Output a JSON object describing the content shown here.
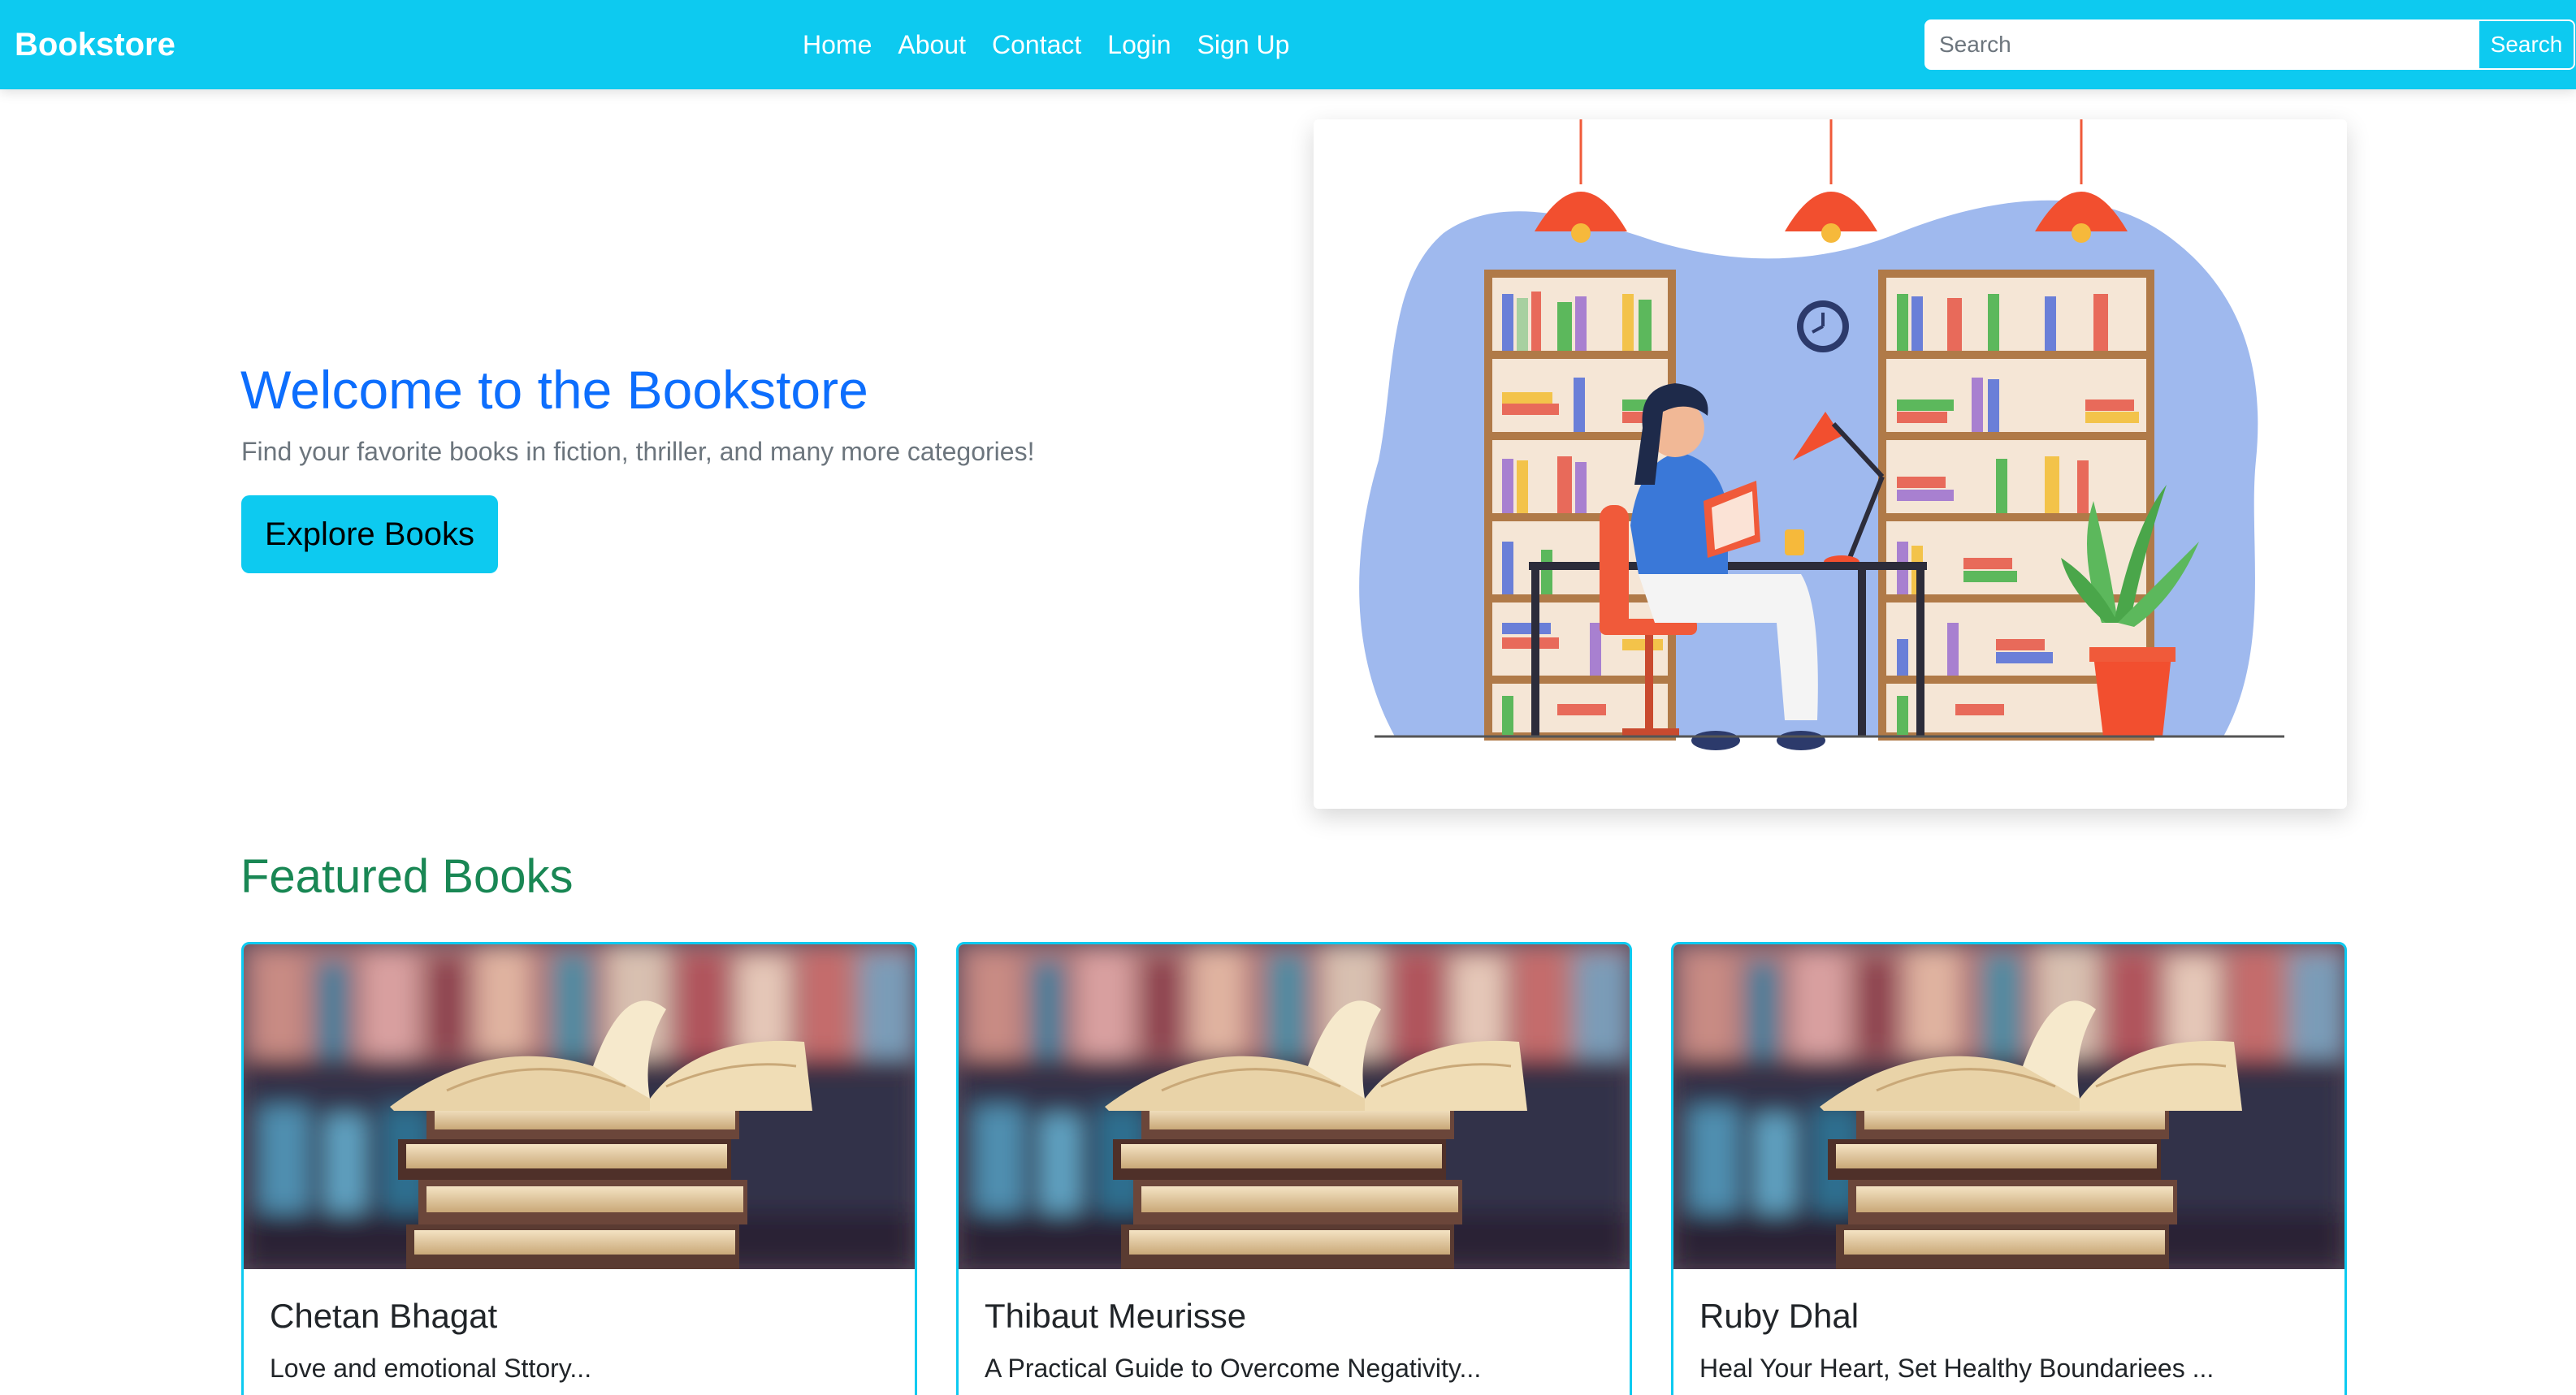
{
  "navbar": {
    "brand": "Bookstore",
    "links": [
      "Home",
      "About",
      "Contact",
      "Login",
      "Sign Up"
    ],
    "search": {
      "placeholder": "Search",
      "button_label": "Search"
    },
    "color": "#0dcaf0"
  },
  "hero": {
    "title": "Welcome to the Bookstore",
    "subtitle": "Find your favorite books in fiction, thriller, and many more categories!",
    "cta_label": "Explore Books",
    "image_icon": "library-reading-illustration"
  },
  "featured": {
    "title": "Featured Books",
    "cards": [
      {
        "title": "Chetan Bhagat",
        "text": "Love and emotional Sttory...",
        "image_icon": "open-book-stack-photo"
      },
      {
        "title": "Thibaut Meurisse",
        "text": "A Practical Guide to Overcome Negativity...",
        "image_icon": "open-book-stack-photo"
      },
      {
        "title": "Ruby Dhal",
        "text": "Heal Your Heart, Set Healthy Boundariees ...",
        "image_icon": "open-book-stack-photo"
      }
    ]
  },
  "colors": {
    "accent": "#0dcaf0",
    "hero_title": "#0d6efd",
    "featured_title": "#198754",
    "muted": "#6c757d"
  }
}
